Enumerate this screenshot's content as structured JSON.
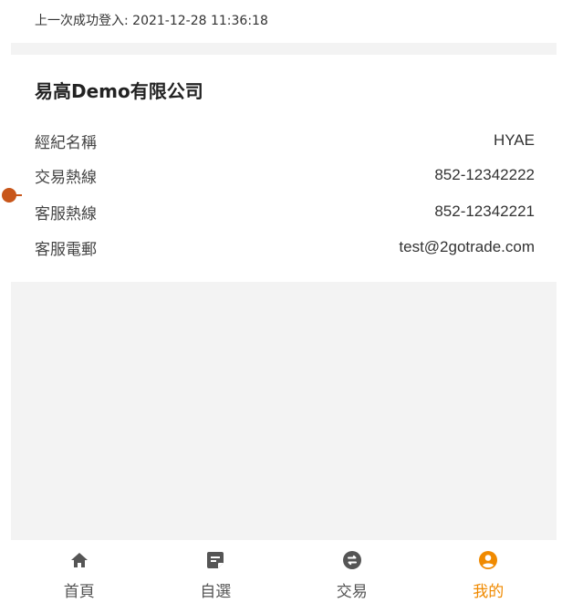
{
  "last_login": {
    "text": "上一次成功登入: 2021-12-28 11:36:18"
  },
  "company": {
    "name": "易高Demo有限公司",
    "rows": [
      {
        "label": "經紀名稱",
        "value": "HYAE"
      },
      {
        "label": "交易熱線",
        "value": "852-12342222"
      },
      {
        "label": "客服熱線",
        "value": "852-12342221"
      },
      {
        "label": "客服電郵",
        "value": "test@2gotrade.com"
      }
    ]
  },
  "tabbar": {
    "items": [
      {
        "label": "首頁",
        "icon": "home-icon"
      },
      {
        "label": "自選",
        "icon": "watchlist-icon"
      },
      {
        "label": "交易",
        "icon": "trade-icon"
      },
      {
        "label": "我的",
        "icon": "profile-icon",
        "active": true
      }
    ]
  },
  "colors": {
    "accent": "#f08a00",
    "icon_gray": "#555555",
    "background": "#f3f3f3",
    "marker": "#c8561a"
  }
}
